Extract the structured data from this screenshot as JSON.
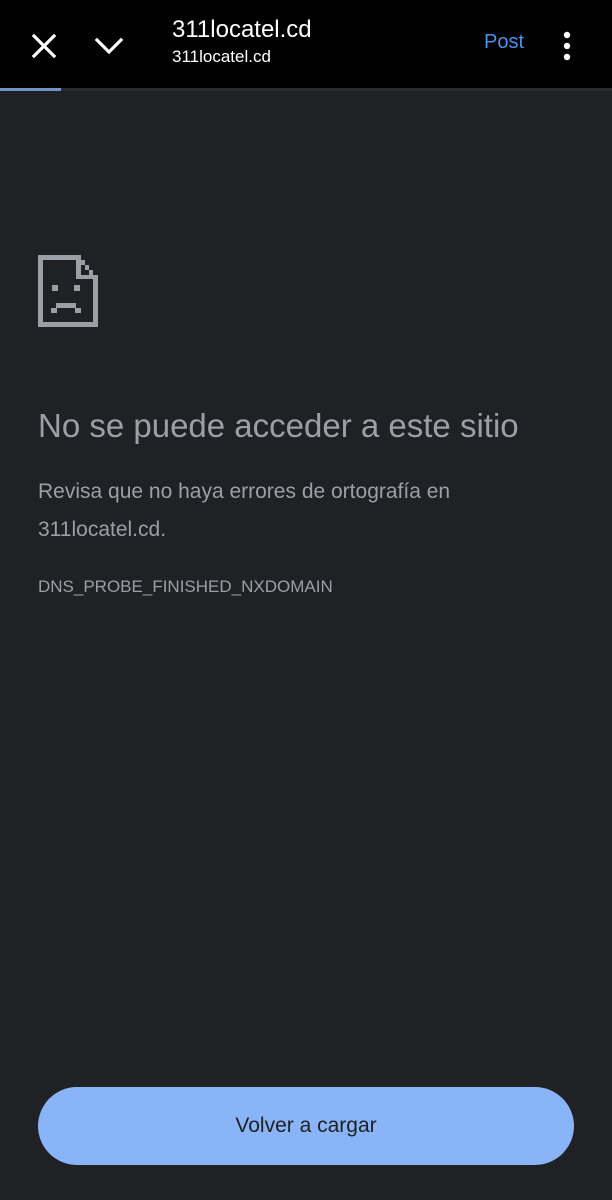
{
  "header": {
    "title": "311locatel.cd",
    "url": "311locatel.cd",
    "post_label": "Post",
    "close_icon": "close-icon",
    "chevron_icon": "chevron-down-icon",
    "menu_icon": "more-vertical-icon",
    "accent_color": "#4d90e8"
  },
  "page_load_progress": 0.1,
  "error_page": {
    "icon": "sad-page-icon",
    "heading": "No se puede acceder a este sitio",
    "message": "Revisa que no haya errores de ortografía en 311locatel.cd.",
    "error_code": "DNS_PROBE_FINISHED_NXDOMAIN",
    "reload_label": "Volver a cargar",
    "button_color": "#8ab4f8",
    "text_color": "#9aa0a6",
    "background_color": "#202124"
  }
}
